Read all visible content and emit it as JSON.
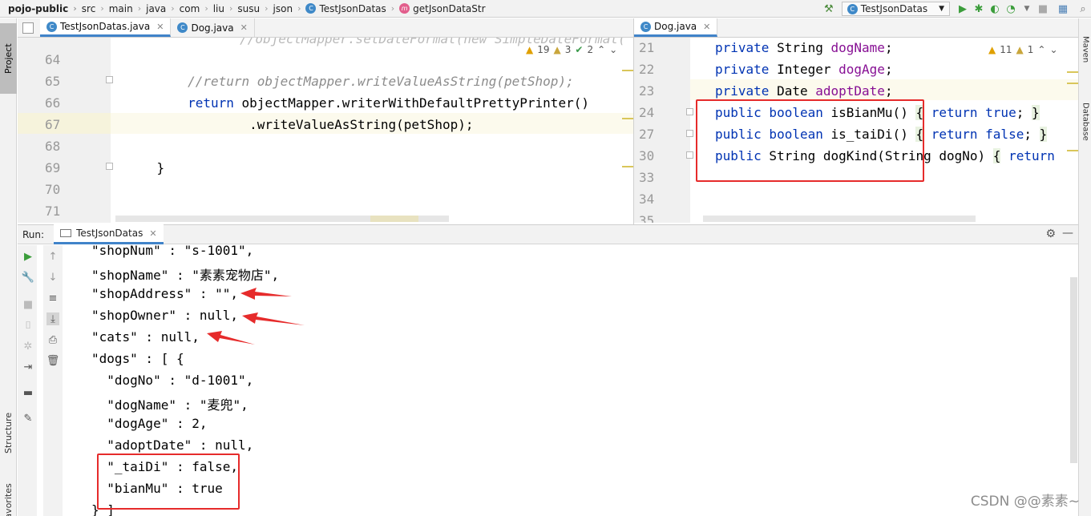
{
  "navbar": {
    "breadcrumbs": [
      "pojo-public",
      "src",
      "main",
      "java",
      "com",
      "liu",
      "susu",
      "json",
      "TestJsonDatas",
      "getJsonDataStr"
    ],
    "run_config": "TestJsonDatas"
  },
  "tool_windows": {
    "left": [
      "Project",
      "Structure",
      "Favorites"
    ],
    "right": [
      "Maven",
      "Database"
    ]
  },
  "left_editor": {
    "tabs": [
      "TestJsonDatas.java",
      "Dog.java"
    ],
    "inspections": {
      "warnings": "19",
      "weak_warnings": "3",
      "typos": "2"
    },
    "lines": [
      {
        "num": "64",
        "text": ""
      },
      {
        "num": "65",
        "text": "        //return objectMapper.writeValueAsString(petShop);"
      },
      {
        "num": "66",
        "text": "        return objectMapper.writerWithDefaultPrettyPrinter()"
      },
      {
        "num": "67",
        "text": "                .writeValueAsString(petShop);"
      },
      {
        "num": "68",
        "text": ""
      },
      {
        "num": "69",
        "text": "    }"
      },
      {
        "num": "70",
        "text": ""
      },
      {
        "num": "71",
        "text": ""
      }
    ],
    "partial_top": "        //objectMapper.setDateFormat(new SimpleDateFormat(\"yyyy"
  },
  "right_editor": {
    "tab": "Dog.java",
    "inspections": {
      "warnings": "11",
      "weak_warnings": "1"
    },
    "lines": [
      {
        "num": "21",
        "text": "    private String dogName;"
      },
      {
        "num": "22",
        "text": "    private Integer dogAge;"
      },
      {
        "num": "23",
        "text": "    private Date adoptDate;"
      },
      {
        "num": "24",
        "text": "    public boolean isBianMu() { return true; }"
      },
      {
        "num": "27",
        "text": "    public boolean is_taiDi() { return false; }"
      },
      {
        "num": "30",
        "text": "    public String dogKind(String dogNo) { return"
      },
      {
        "num": "33",
        "text": ""
      },
      {
        "num": "34",
        "text": ""
      },
      {
        "num": "35",
        "text": ""
      }
    ]
  },
  "run": {
    "label": "Run:",
    "tab": "TestJsonDatas",
    "output": [
      "\"shopNum\" : \"s-1001\",",
      "\"shopName\" : \"素素宠物店\",",
      "\"shopAddress\" : \"\",",
      "\"shopOwner\" : null,",
      "\"cats\" : null,",
      "\"dogs\" : [ {",
      "  \"dogNo\" : \"d-1001\",",
      "  \"dogName\" : \"麦兜\",",
      "  \"dogAge\" : 2,",
      "  \"adoptDate\" : null,",
      "  \"_taiDi\" : false,",
      "  \"bianMu\" : true",
      "} ]"
    ]
  },
  "watermark": "CSDN @@素素~",
  "colors": {
    "keyword": "#0033b3",
    "field": "#871094",
    "comment": "#8c8c8c",
    "annotation": "#e62b2b",
    "accent": "#4083c9"
  }
}
